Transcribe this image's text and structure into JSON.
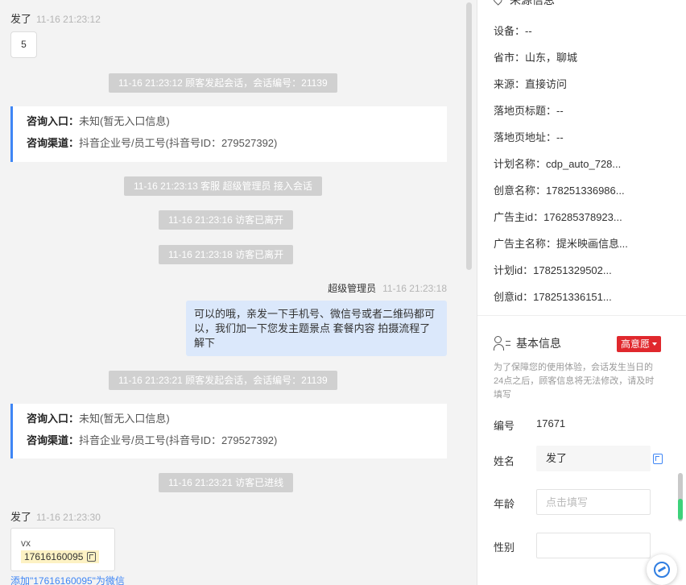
{
  "chat": {
    "msg1": {
      "sender": "发了",
      "time": "11-16 21:23:12",
      "content": "5"
    },
    "sys1": "11-16 21:23:12 顾客发起会话，会话编号：21139",
    "card1": {
      "entry_label": "咨询入口：",
      "entry_value": "未知(暂无入口信息)",
      "channel_label": "咨询渠道：",
      "channel_value": "抖音企业号/员工号(抖音号ID：279527392)"
    },
    "sys2": "11-16 21:23:13 客服 超级管理员 接入会话",
    "sys3": "11-16 21:23:16 访客已离开",
    "sys4": "11-16 21:23:18 访客已离开",
    "agent_msg": {
      "sender": "超级管理员",
      "time": "11-16 21:23:18",
      "content": "可以的哦，亲发一下手机号、微信号或者二维码都可以，我们加一下您发主题景点 套餐内容 拍摄流程了解下"
    },
    "sys5": "11-16 21:23:21 顾客发起会话，会话编号：21139",
    "card2": {
      "entry_label": "咨询入口：",
      "entry_value": "未知(暂无入口信息)",
      "channel_label": "咨询渠道：",
      "channel_value": "抖音企业号/员工号(抖音号ID：279527392)"
    },
    "sys6": "11-16 21:23:21 访客已进线",
    "msg2": {
      "sender": "发了",
      "time": "11-16 21:23:30",
      "title": "vx",
      "number": "17616160095"
    },
    "truncated_link": "添加\"17616160095\"为微信"
  },
  "source_info": {
    "title": "来源信息",
    "rows": [
      "设备：--",
      "省市：山东，聊城",
      "来源：直接访问",
      "落地页标题：--",
      "落地页地址：--",
      "计划名称：cdp_auto_728...",
      "创意名称：178251336986...",
      "广告主id：176285378923...",
      "广告主名称：提米映画信息...",
      "计划id：178251329502...",
      "创意id：178251336151..."
    ]
  },
  "basic_info": {
    "title": "基本信息",
    "intent_badge": "高意愿",
    "notice": "为了保障您的使用体验，会话发生当日的24点之后，顾客信息将无法修改，请及时填写",
    "id_label": "编号",
    "id_value": "17671",
    "name_label": "姓名",
    "name_value": "发了",
    "age_label": "年龄",
    "age_placeholder": "点击填写",
    "gender_label": "性别",
    "gender_value": ""
  },
  "icons": {
    "location": "map-pin-icon",
    "person": "person-list-icon",
    "copy": "copy-icon",
    "assistant": "assistant-icon",
    "dropdown": "caret-down-icon"
  },
  "colors": {
    "accent": "#3f86f5",
    "badge": "#e0282d",
    "agent_bubble": "#dbe8fb",
    "system_pill": "#d0d0d0",
    "highlight": "#fdf2c4"
  }
}
